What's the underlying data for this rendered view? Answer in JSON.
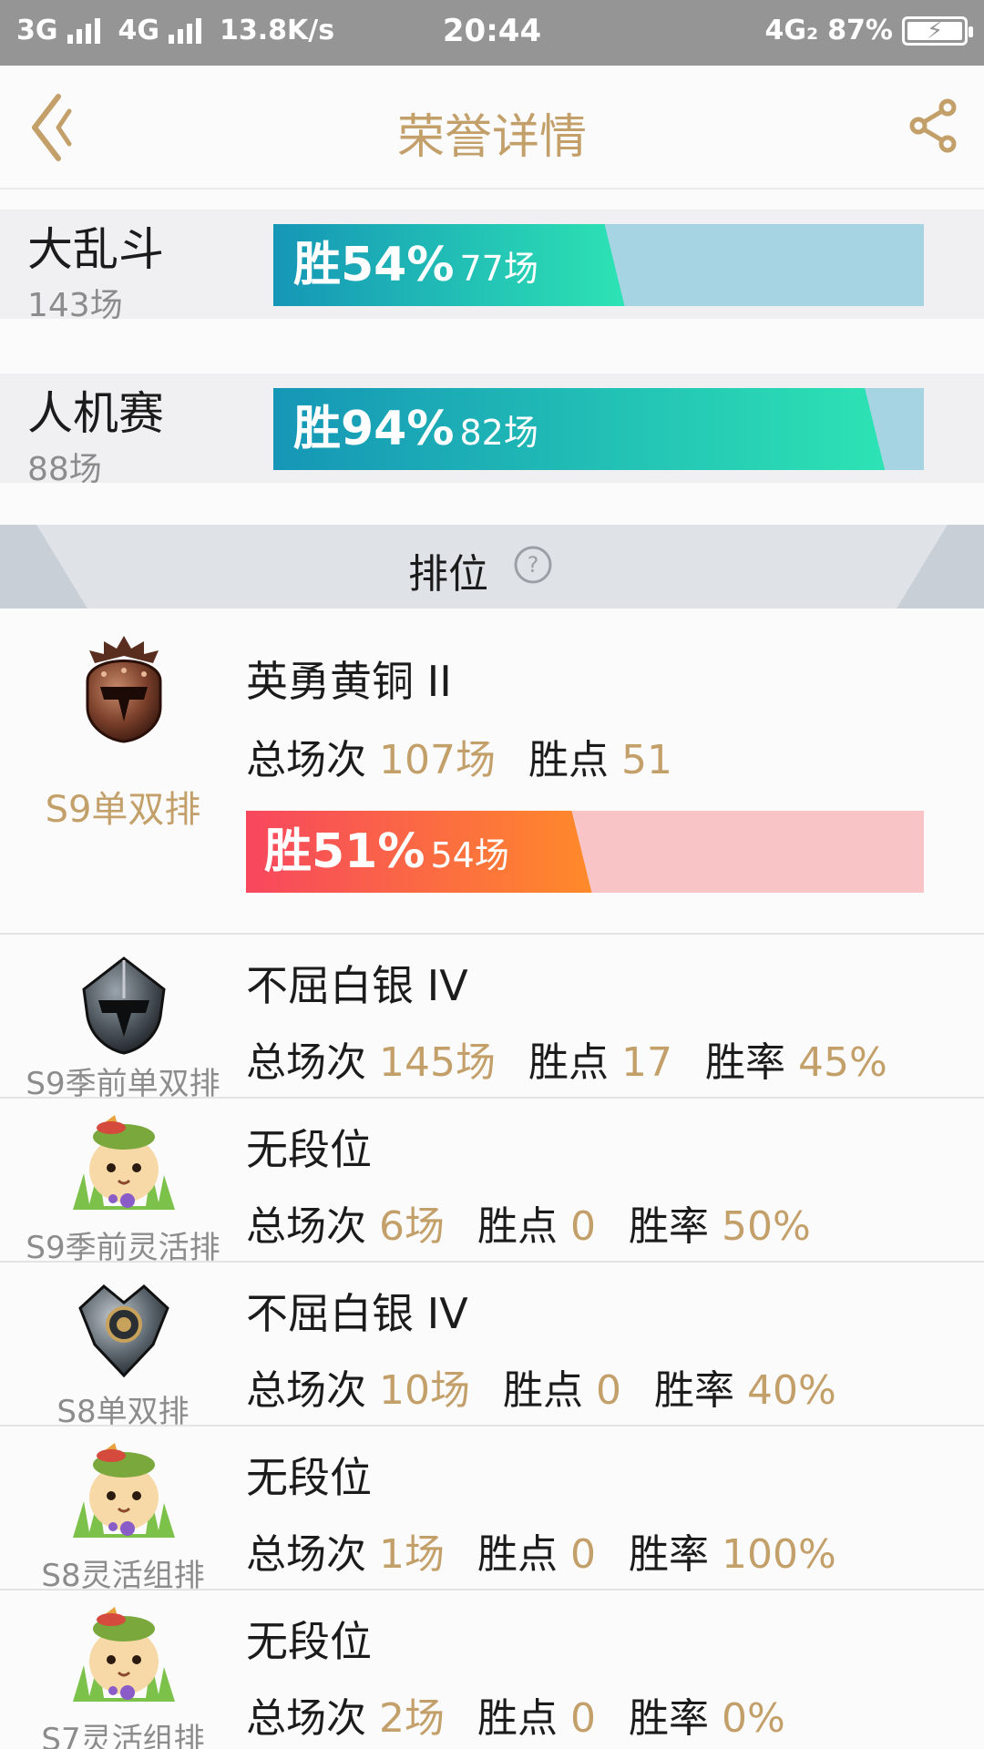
{
  "status_bar": {
    "net1": "3G",
    "net2": "4G",
    "speed": "13.8K/s",
    "time": "20:44",
    "net3": "4G₂",
    "battery": "87%"
  },
  "header": {
    "title": "荣誉详情"
  },
  "modes": [
    {
      "name": "大乱斗",
      "count": "143场",
      "win_label": "胜54%",
      "win_games": "77场",
      "win_fraction": 0.54
    },
    {
      "name": "人机赛",
      "count": "88场",
      "win_label": "胜94%",
      "win_games": "82场",
      "win_fraction": 0.94
    }
  ],
  "ranked": {
    "title": "排位",
    "main": {
      "season": "S9单双排",
      "rank": "英勇黄铜 II",
      "total_label": "总场次",
      "total_value": "107场",
      "points_label": "胜点",
      "points_value": "51",
      "win_label": "胜51%",
      "win_games": "54场",
      "win_fraction": 0.51
    },
    "rows": [
      {
        "season": "S9季前单双排",
        "rank": "不屈白银 IV",
        "total_label": "总场次",
        "total_value": "145场",
        "points_label": "胜点",
        "points_value": "17",
        "rate_label": "胜率",
        "rate_value": "45%"
      },
      {
        "season": "S9季前灵活排",
        "rank": "无段位",
        "total_label": "总场次",
        "total_value": "6场",
        "points_label": "胜点",
        "points_value": "0",
        "rate_label": "胜率",
        "rate_value": "50%"
      },
      {
        "season": "S8单双排",
        "rank": "不屈白银 IV",
        "total_label": "总场次",
        "total_value": "10场",
        "points_label": "胜点",
        "points_value": "0",
        "rate_label": "胜率",
        "rate_value": "40%"
      },
      {
        "season": "S8灵活组排",
        "rank": "无段位",
        "total_label": "总场次",
        "total_value": "1场",
        "points_label": "胜点",
        "points_value": "0",
        "rate_label": "胜率",
        "rate_value": "100%"
      },
      {
        "season": "S7灵活组排",
        "rank": "无段位",
        "total_label": "总场次",
        "total_value": "2场",
        "points_label": "胜点",
        "points_value": "0",
        "rate_label": "胜率",
        "rate_value": "0%"
      }
    ]
  },
  "colors": {
    "accent_gold": "#c3a06a",
    "teal_start": "#1596b6",
    "teal_end": "#2de3b4",
    "teal_track": "#a7d4e2",
    "red_start": "#f7475e",
    "red_end": "#ff8a2a",
    "red_track": "#f8c4c6"
  },
  "icons": {
    "back": "chevron-left-icon",
    "share": "share-icon",
    "help": "help-circle-icon",
    "bronze": "bronze-helmet-badge-icon",
    "silver": "silver-helmet-badge-icon",
    "unranked": "poro-unranked-icon"
  }
}
